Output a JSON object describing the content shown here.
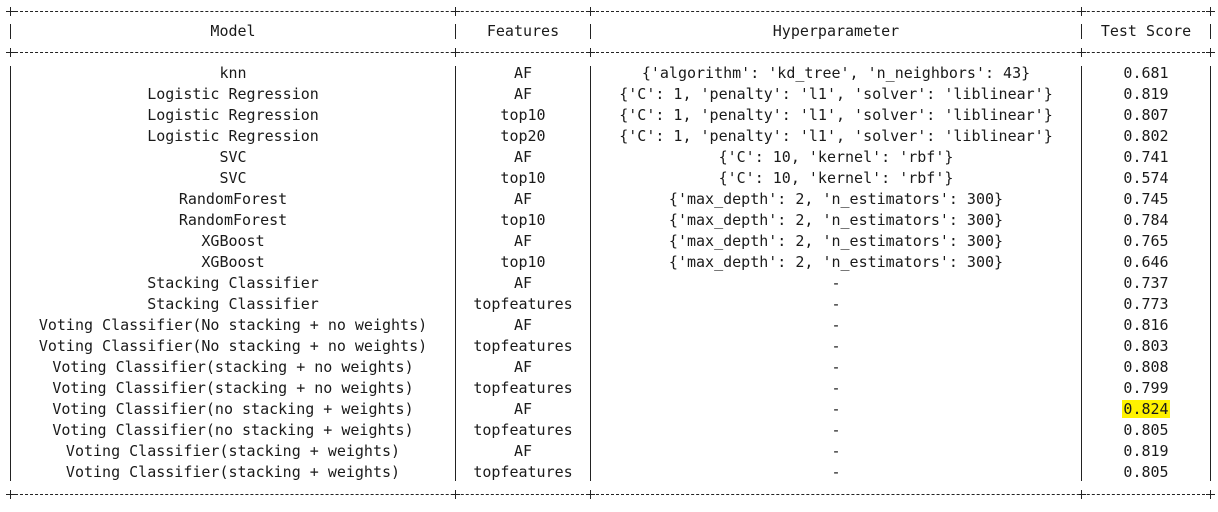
{
  "table": {
    "headers": [
      "Model",
      "Features",
      "Hyperparameter",
      "Test Score"
    ],
    "rows": [
      {
        "model": "knn",
        "features": "AF",
        "hyperparameter": "{'algorithm': 'kd_tree', 'n_neighbors': 43}",
        "score": "0.681"
      },
      {
        "model": "Logistic Regression",
        "features": "AF",
        "hyperparameter": "{'C': 1, 'penalty': 'l1', 'solver': 'liblinear'}",
        "score": "0.819"
      },
      {
        "model": "Logistic Regression",
        "features": "top10",
        "hyperparameter": "{'C': 1, 'penalty': 'l1', 'solver': 'liblinear'}",
        "score": "0.807"
      },
      {
        "model": "Logistic Regression",
        "features": "top20",
        "hyperparameter": "{'C': 1, 'penalty': 'l1', 'solver': 'liblinear'}",
        "score": "0.802"
      },
      {
        "model": "SVC",
        "features": "AF",
        "hyperparameter": "{'C': 10, 'kernel': 'rbf'}",
        "score": "0.741"
      },
      {
        "model": "SVC",
        "features": "top10",
        "hyperparameter": "{'C': 10, 'kernel': 'rbf'}",
        "score": "0.574"
      },
      {
        "model": "RandomForest",
        "features": "AF",
        "hyperparameter": "{'max_depth': 2, 'n_estimators': 300}",
        "score": "0.745"
      },
      {
        "model": "RandomForest",
        "features": "top10",
        "hyperparameter": "{'max_depth': 2, 'n_estimators': 300}",
        "score": "0.784"
      },
      {
        "model": "XGBoost",
        "features": "AF",
        "hyperparameter": "{'max_depth': 2, 'n_estimators': 300}",
        "score": "0.765"
      },
      {
        "model": "XGBoost",
        "features": "top10",
        "hyperparameter": "{'max_depth': 2, 'n_estimators': 300}",
        "score": "0.646"
      },
      {
        "model": "Stacking Classifier",
        "features": "AF",
        "hyperparameter": "-",
        "score": "0.737"
      },
      {
        "model": "Stacking Classifier",
        "features": "topfeatures",
        "hyperparameter": "-",
        "score": "0.773"
      },
      {
        "model": "Voting Classifier(No stacking + no weights)",
        "features": "AF",
        "hyperparameter": "-",
        "score": "0.816"
      },
      {
        "model": "Voting Classifier(No stacking + no weights)",
        "features": "topfeatures",
        "hyperparameter": "-",
        "score": "0.803"
      },
      {
        "model": "Voting Classifier(stacking + no weights)",
        "features": "AF",
        "hyperparameter": "-",
        "score": "0.808"
      },
      {
        "model": "Voting Classifier(stacking + no weights)",
        "features": "topfeatures",
        "hyperparameter": "-",
        "score": "0.799"
      },
      {
        "model": "Voting Classifier(no stacking + weights)",
        "features": "AF",
        "hyperparameter": "-",
        "score": "0.824",
        "highlight": true
      },
      {
        "model": "Voting Classifier(no stacking + weights)",
        "features": "topfeatures",
        "hyperparameter": "-",
        "score": "0.805"
      },
      {
        "model": "Voting Classifier(stacking + weights)",
        "features": "AF",
        "hyperparameter": "-",
        "score": "0.819"
      },
      {
        "model": "Voting Classifier(stacking + weights)",
        "features": "topfeatures",
        "hyperparameter": "-",
        "score": "0.805"
      }
    ]
  },
  "colors": {
    "highlight": "#fff200",
    "text": "#1a1a1a",
    "border": "#222222"
  }
}
